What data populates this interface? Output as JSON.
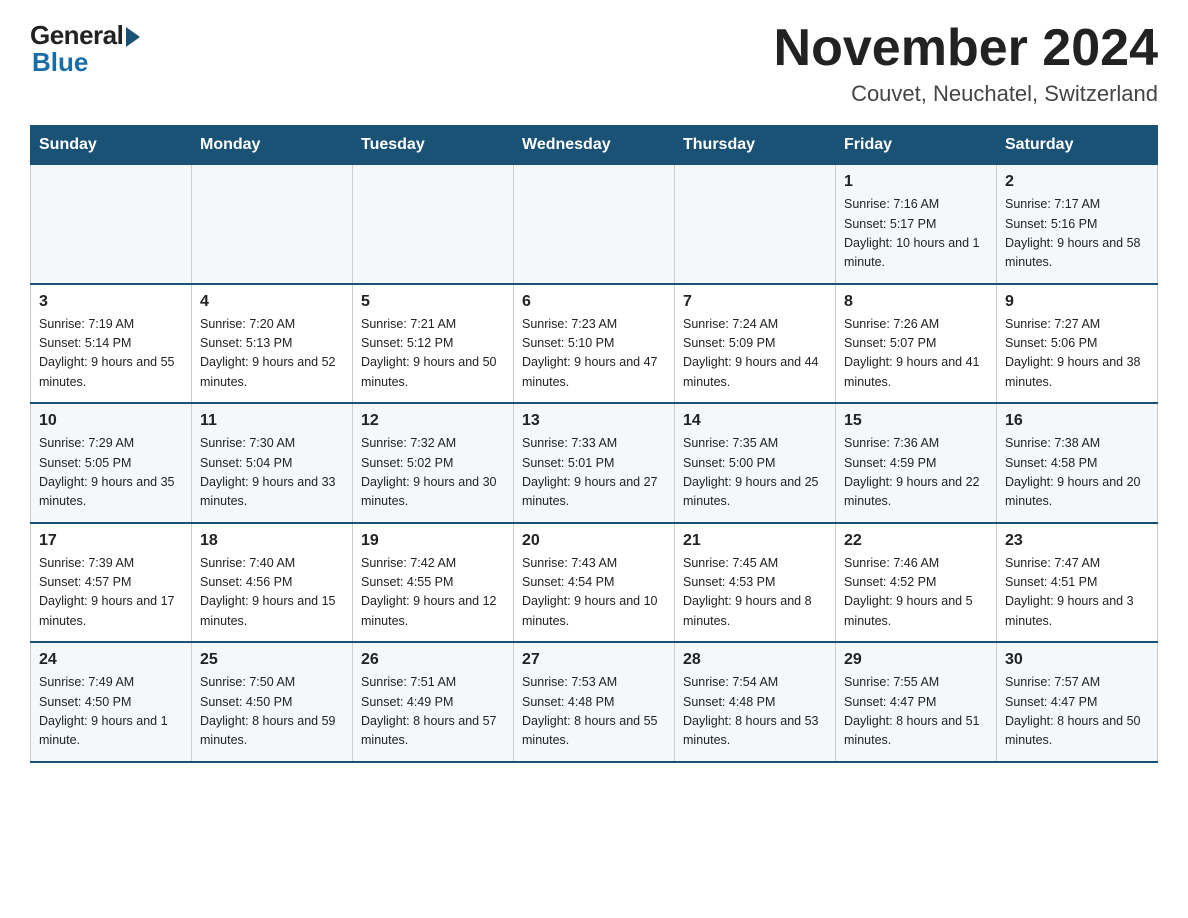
{
  "logo": {
    "general": "General",
    "blue": "Blue"
  },
  "header": {
    "title": "November 2024",
    "location": "Couvet, Neuchatel, Switzerland"
  },
  "days_of_week": [
    "Sunday",
    "Monday",
    "Tuesday",
    "Wednesday",
    "Thursday",
    "Friday",
    "Saturday"
  ],
  "weeks": [
    [
      {
        "day": "",
        "info": ""
      },
      {
        "day": "",
        "info": ""
      },
      {
        "day": "",
        "info": ""
      },
      {
        "day": "",
        "info": ""
      },
      {
        "day": "",
        "info": ""
      },
      {
        "day": "1",
        "info": "Sunrise: 7:16 AM\nSunset: 5:17 PM\nDaylight: 10 hours and 1 minute."
      },
      {
        "day": "2",
        "info": "Sunrise: 7:17 AM\nSunset: 5:16 PM\nDaylight: 9 hours and 58 minutes."
      }
    ],
    [
      {
        "day": "3",
        "info": "Sunrise: 7:19 AM\nSunset: 5:14 PM\nDaylight: 9 hours and 55 minutes."
      },
      {
        "day": "4",
        "info": "Sunrise: 7:20 AM\nSunset: 5:13 PM\nDaylight: 9 hours and 52 minutes."
      },
      {
        "day": "5",
        "info": "Sunrise: 7:21 AM\nSunset: 5:12 PM\nDaylight: 9 hours and 50 minutes."
      },
      {
        "day": "6",
        "info": "Sunrise: 7:23 AM\nSunset: 5:10 PM\nDaylight: 9 hours and 47 minutes."
      },
      {
        "day": "7",
        "info": "Sunrise: 7:24 AM\nSunset: 5:09 PM\nDaylight: 9 hours and 44 minutes."
      },
      {
        "day": "8",
        "info": "Sunrise: 7:26 AM\nSunset: 5:07 PM\nDaylight: 9 hours and 41 minutes."
      },
      {
        "day": "9",
        "info": "Sunrise: 7:27 AM\nSunset: 5:06 PM\nDaylight: 9 hours and 38 minutes."
      }
    ],
    [
      {
        "day": "10",
        "info": "Sunrise: 7:29 AM\nSunset: 5:05 PM\nDaylight: 9 hours and 35 minutes."
      },
      {
        "day": "11",
        "info": "Sunrise: 7:30 AM\nSunset: 5:04 PM\nDaylight: 9 hours and 33 minutes."
      },
      {
        "day": "12",
        "info": "Sunrise: 7:32 AM\nSunset: 5:02 PM\nDaylight: 9 hours and 30 minutes."
      },
      {
        "day": "13",
        "info": "Sunrise: 7:33 AM\nSunset: 5:01 PM\nDaylight: 9 hours and 27 minutes."
      },
      {
        "day": "14",
        "info": "Sunrise: 7:35 AM\nSunset: 5:00 PM\nDaylight: 9 hours and 25 minutes."
      },
      {
        "day": "15",
        "info": "Sunrise: 7:36 AM\nSunset: 4:59 PM\nDaylight: 9 hours and 22 minutes."
      },
      {
        "day": "16",
        "info": "Sunrise: 7:38 AM\nSunset: 4:58 PM\nDaylight: 9 hours and 20 minutes."
      }
    ],
    [
      {
        "day": "17",
        "info": "Sunrise: 7:39 AM\nSunset: 4:57 PM\nDaylight: 9 hours and 17 minutes."
      },
      {
        "day": "18",
        "info": "Sunrise: 7:40 AM\nSunset: 4:56 PM\nDaylight: 9 hours and 15 minutes."
      },
      {
        "day": "19",
        "info": "Sunrise: 7:42 AM\nSunset: 4:55 PM\nDaylight: 9 hours and 12 minutes."
      },
      {
        "day": "20",
        "info": "Sunrise: 7:43 AM\nSunset: 4:54 PM\nDaylight: 9 hours and 10 minutes."
      },
      {
        "day": "21",
        "info": "Sunrise: 7:45 AM\nSunset: 4:53 PM\nDaylight: 9 hours and 8 minutes."
      },
      {
        "day": "22",
        "info": "Sunrise: 7:46 AM\nSunset: 4:52 PM\nDaylight: 9 hours and 5 minutes."
      },
      {
        "day": "23",
        "info": "Sunrise: 7:47 AM\nSunset: 4:51 PM\nDaylight: 9 hours and 3 minutes."
      }
    ],
    [
      {
        "day": "24",
        "info": "Sunrise: 7:49 AM\nSunset: 4:50 PM\nDaylight: 9 hours and 1 minute."
      },
      {
        "day": "25",
        "info": "Sunrise: 7:50 AM\nSunset: 4:50 PM\nDaylight: 8 hours and 59 minutes."
      },
      {
        "day": "26",
        "info": "Sunrise: 7:51 AM\nSunset: 4:49 PM\nDaylight: 8 hours and 57 minutes."
      },
      {
        "day": "27",
        "info": "Sunrise: 7:53 AM\nSunset: 4:48 PM\nDaylight: 8 hours and 55 minutes."
      },
      {
        "day": "28",
        "info": "Sunrise: 7:54 AM\nSunset: 4:48 PM\nDaylight: 8 hours and 53 minutes."
      },
      {
        "day": "29",
        "info": "Sunrise: 7:55 AM\nSunset: 4:47 PM\nDaylight: 8 hours and 51 minutes."
      },
      {
        "day": "30",
        "info": "Sunrise: 7:57 AM\nSunset: 4:47 PM\nDaylight: 8 hours and 50 minutes."
      }
    ]
  ]
}
